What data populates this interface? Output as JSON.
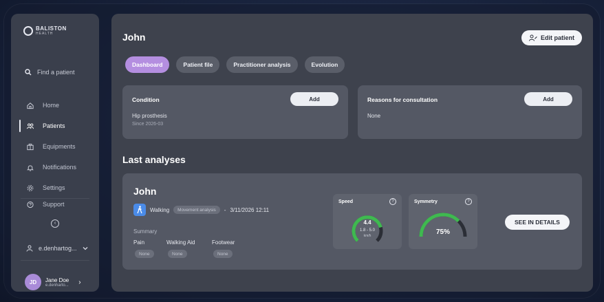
{
  "brand": {
    "name": "BALISTON",
    "sub": "HEALTH"
  },
  "sidebar": {
    "search_placeholder": "Find a patient",
    "items": [
      {
        "label": "Home",
        "icon": "home-icon"
      },
      {
        "label": "Patients",
        "icon": "patients-icon",
        "active": true
      },
      {
        "label": "Equipments",
        "icon": "equipment-icon"
      },
      {
        "label": "Notifications",
        "icon": "bell-icon"
      },
      {
        "label": "Settings",
        "icon": "gear-icon"
      },
      {
        "label": "Support",
        "icon": "support-icon"
      }
    ],
    "account_label": "e.denhartog...",
    "user": {
      "initials": "JD",
      "name": "Jane Doe",
      "email": "e.denharto..."
    }
  },
  "header": {
    "title": "John",
    "edit_label": "Edit patient"
  },
  "tabs": [
    {
      "label": "Dashboard",
      "active": true
    },
    {
      "label": "Patient file"
    },
    {
      "label": "Practitioner analysis"
    },
    {
      "label": "Evolution"
    }
  ],
  "condition": {
    "title": "Condition",
    "add_label": "Add",
    "value": "Hip prosthesis",
    "since": "Since 2026-03"
  },
  "reasons": {
    "title": "Reasons for consultation",
    "add_label": "Add",
    "value": "None"
  },
  "last_analyses": {
    "title": "Last analyses",
    "card": {
      "name": "John",
      "activity": "Walking",
      "type_badge": "Movement analysis",
      "separator": "-",
      "date": "3/11/2026 12:11",
      "summary_label": "Summary",
      "fields": [
        {
          "label": "Pain",
          "value": "None"
        },
        {
          "label": "Walking Aid",
          "value": "None"
        },
        {
          "label": "Footwear",
          "value": "None"
        }
      ],
      "speed": {
        "title": "Speed",
        "value": "4.4",
        "range": "1.8 - 5.0",
        "unit": "km/h",
        "fill_fraction": 0.78
      },
      "symmetry": {
        "title": "Symmetry",
        "value": "75%",
        "fill_fraction": 0.75
      },
      "details_label": "SEE IN DETAILS"
    }
  },
  "colors": {
    "accent": "#b48ee0",
    "gauge_green": "#3fb950",
    "walk_blue": "#4a8be8"
  }
}
